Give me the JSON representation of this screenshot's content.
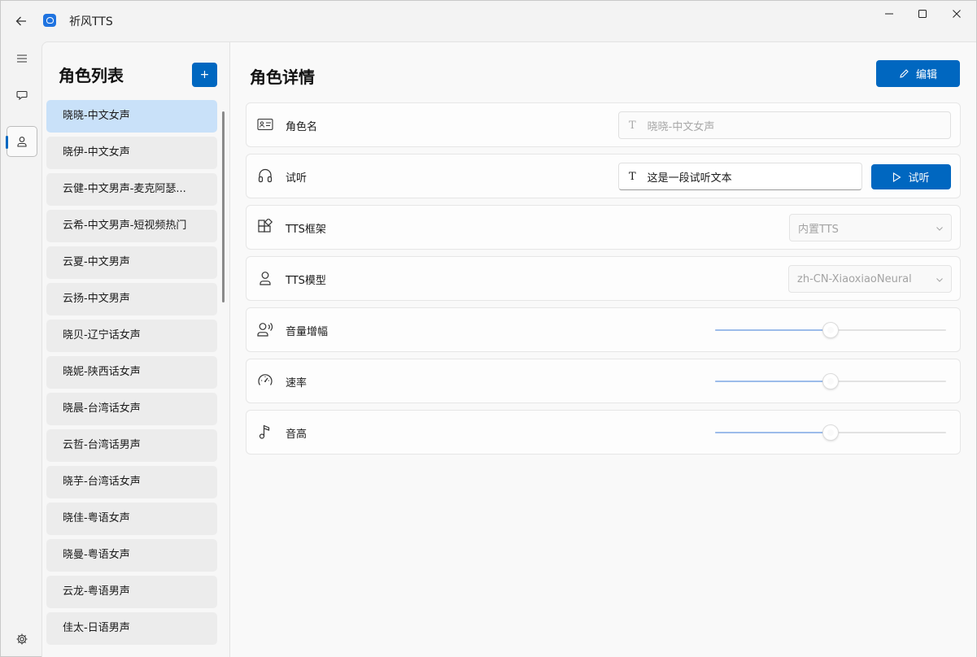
{
  "window": {
    "title": "祈风TTS"
  },
  "list_panel": {
    "title": "角色列表",
    "add_label": "+",
    "roles": [
      {
        "label": "晓晓-中文女声",
        "selected": true
      },
      {
        "label": "晓伊-中文女声"
      },
      {
        "label": "云健-中文男声-麦克阿瑟..."
      },
      {
        "label": "云希-中文男声-短视频热门"
      },
      {
        "label": "云夏-中文男声"
      },
      {
        "label": "云扬-中文男声"
      },
      {
        "label": "晓贝-辽宁话女声"
      },
      {
        "label": "晓妮-陕西话女声"
      },
      {
        "label": "晓晨-台湾话女声"
      },
      {
        "label": "云哲-台湾话男声"
      },
      {
        "label": "晓芋-台湾话女声"
      },
      {
        "label": "晓佳-粤语女声"
      },
      {
        "label": "晓曼-粤语女声"
      },
      {
        "label": "云龙-粤语男声"
      },
      {
        "label": "佳太-日语男声"
      }
    ]
  },
  "detail": {
    "title": "角色详情",
    "edit_label": "编辑",
    "name_row": {
      "label": "角色名",
      "glyph": "T",
      "value": "晓晓-中文女声"
    },
    "preview_row": {
      "label": "试听",
      "glyph": "T",
      "value": "这是一段试听文本",
      "button_label": "试听"
    },
    "framework_row": {
      "label": "TTS框架",
      "value": "内置TTS"
    },
    "model_row": {
      "label": "TTS模型",
      "value": "zh-CN-XiaoxiaoNeural"
    },
    "volume_row": {
      "label": "音量增幅",
      "level": 0.5
    },
    "rate_row": {
      "label": "速率",
      "level": 0.5
    },
    "pitch_row": {
      "label": "音高",
      "level": 0.5
    }
  },
  "colors": {
    "accent": "#0067c0",
    "selected_item": "#c9e1f9",
    "slider_fill": "#9cbcea"
  }
}
